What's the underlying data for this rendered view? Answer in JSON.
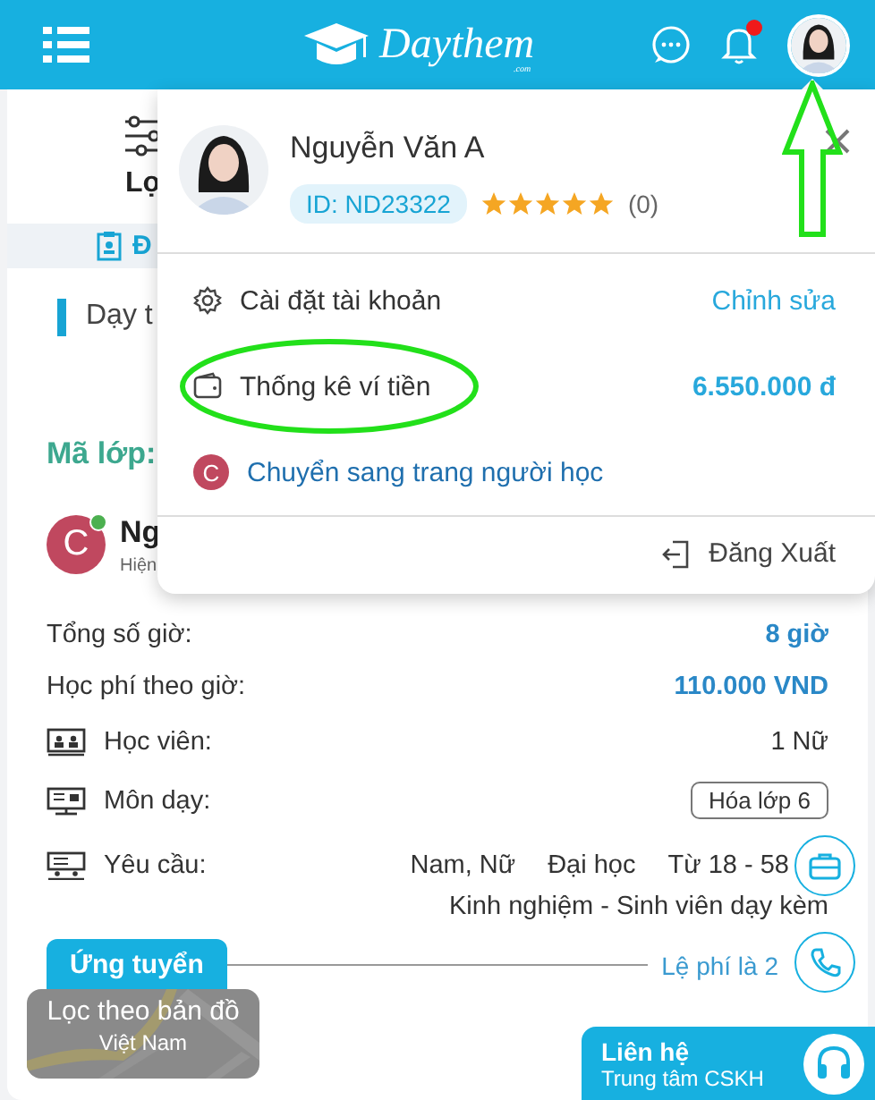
{
  "header": {
    "logo_text": "Daythem",
    "logo_suffix": ".com",
    "notification_dot": true
  },
  "filter": {
    "label": "Lọ"
  },
  "tab": {
    "label": "Đ"
  },
  "card_title": "Dạy t",
  "class_code_label": "Mã lớp:",
  "poster": {
    "initial": "C",
    "online": true,
    "name": "Ng",
    "subtitle": "Hiện"
  },
  "details": [
    {
      "kind": "hours",
      "label": "Tổng số giờ:",
      "values": [
        "8 giờ"
      ]
    },
    {
      "kind": "fee",
      "label": "Học phí theo giờ:",
      "values": [
        "110.000 VND"
      ]
    },
    {
      "kind": "students",
      "label": "Học viên:",
      "values": [
        "1 Nữ"
      ]
    },
    {
      "kind": "subject",
      "label": "Môn dạy:",
      "values": [
        "Hóa lớp 6"
      ]
    },
    {
      "kind": "requirements",
      "label": "Yêu cầu:",
      "values": [
        "Nam, Nữ",
        "Đại học",
        "Từ 18 - 58"
      ],
      "extra": "Kinh nghiệm - Sinh viên dạy kèm"
    }
  ],
  "apply_button": "Ứng tuyển",
  "fee_note": "Lệ phí là 2",
  "map_filter": {
    "title": "Lọc theo bản đồ",
    "subtitle": "Việt Nam"
  },
  "contact": {
    "title": "Liên hệ",
    "subtitle": "Trung tâm CSKH"
  },
  "profile_menu": {
    "name": "Nguyễn Văn A",
    "id_badge": "ID: ND23322",
    "stars": 5,
    "rating_count": "(0)",
    "items": [
      {
        "kind": "settings",
        "label": "Cài đặt tài khoản",
        "action": "Chỉnh sửa"
      },
      {
        "kind": "wallet",
        "label": "Thống kê ví tiền",
        "value": "6.550.000 đ"
      },
      {
        "kind": "switch",
        "initial": "C",
        "label": "Chuyển sang trang người học"
      }
    ],
    "logout": "Đăng Xuất"
  },
  "annotations": [
    {
      "kind": "arrow"
    },
    {
      "kind": "ellipse"
    }
  ]
}
